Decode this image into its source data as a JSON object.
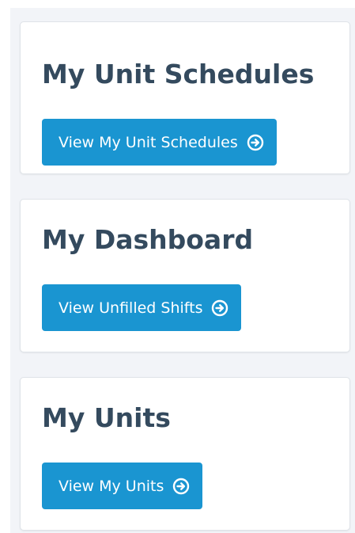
{
  "cards": [
    {
      "title": "My Unit Schedules",
      "button_label": "View My Unit Schedules",
      "button_icon": "arrow-circle-right-icon"
    },
    {
      "title": "My Dashboard",
      "button_label": "View Unfilled Shifts",
      "button_icon": "arrow-circle-right-icon"
    },
    {
      "title": "My Units",
      "button_label": "View My Units",
      "button_icon": "arrow-circle-right-icon"
    }
  ],
  "colors": {
    "title": "#344a5e",
    "button": "#1a95d1",
    "background": "#f2f4f8"
  }
}
